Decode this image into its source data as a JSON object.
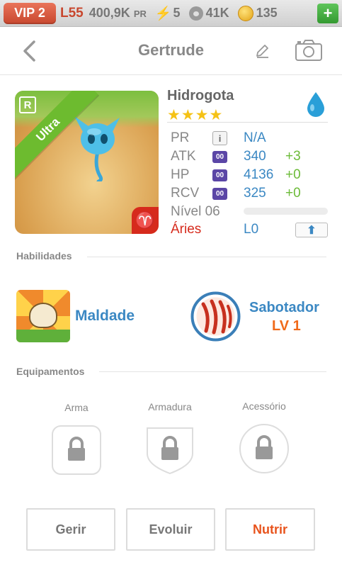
{
  "statusbar": {
    "vip": "VIP 2",
    "level": "L55",
    "power": "400,9K",
    "power_unit": "PR",
    "energy": "5",
    "paws": "41K",
    "coins": "135",
    "add": "+"
  },
  "header": {
    "title": "Gertrude"
  },
  "monster": {
    "name": "Hidrogota",
    "stars": "★★★★",
    "rarity": "Ultra",
    "rank_badge": "R",
    "sign_glyph": "♈",
    "element": "water-drop-icon"
  },
  "stats": {
    "pr": {
      "label": "PR",
      "info": "i",
      "value": "N/A"
    },
    "atk": {
      "label": "ATK",
      "icon": "00",
      "value": "340",
      "bonus": "+3"
    },
    "hp": {
      "label": "HP",
      "icon": "00",
      "value": "4136",
      "bonus": "+0"
    },
    "rcv": {
      "label": "RCV",
      "icon": "00",
      "value": "325",
      "bonus": "+0"
    },
    "level_label": "Nível 06",
    "level_progress": 0,
    "sign_name": "Áries",
    "sign_level": "L0",
    "upgrade": "⬆"
  },
  "abilities": {
    "section_title": "Habilidades",
    "items": [
      {
        "name": "Maldade"
      },
      {
        "name": "Sabotador",
        "level": "LV 1"
      }
    ]
  },
  "equipment": {
    "section_title": "Equipamentos",
    "slots": [
      {
        "label": "Arma"
      },
      {
        "label": "Armadura"
      },
      {
        "label": "Acessório"
      }
    ]
  },
  "actions": {
    "manage": "Gerir",
    "evolve": "Evoluir",
    "feed": "Nutrir"
  },
  "colors": {
    "accent_blue": "#3b88c3",
    "accent_orange": "#e8531c",
    "aries_red": "#d62a1c",
    "bonus_green": "#6cbb38"
  }
}
